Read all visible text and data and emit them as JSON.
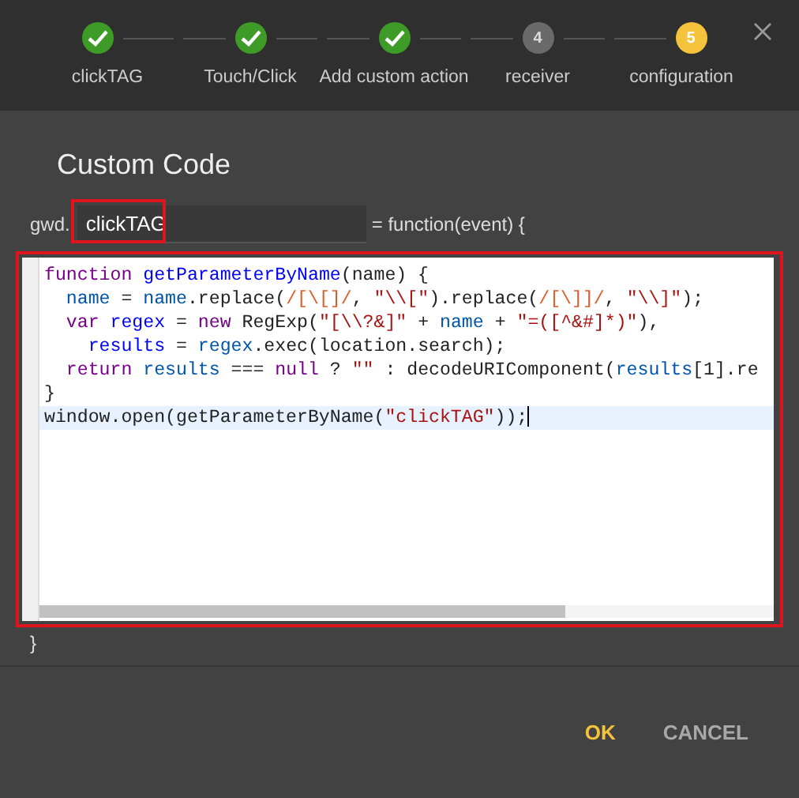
{
  "steps": [
    {
      "label": "clickTAG",
      "done": true,
      "current": false
    },
    {
      "label": "Touch/Click",
      "done": true,
      "current": false
    },
    {
      "label": "Add custom action",
      "done": true,
      "current": false
    },
    {
      "label": "receiver",
      "number": "4",
      "done": false,
      "current": false
    },
    {
      "label": "configuration",
      "number": "5",
      "done": false,
      "current": true
    }
  ],
  "title": "Custom Code",
  "signature": {
    "prefix": "gwd.",
    "value": "clickTAG",
    "suffix": "= function(event) {"
  },
  "code_lines": [
    {
      "active": false,
      "tokens": [
        {
          "kind": "keyword",
          "text": "function "
        },
        {
          "kind": "def",
          "text": "getParameterByName"
        },
        {
          "kind": "plain",
          "text": "(name) {"
        }
      ]
    },
    {
      "active": false,
      "tokens": [
        {
          "kind": "variable",
          "text": "  name"
        },
        {
          "kind": "plain",
          "text": " = "
        },
        {
          "kind": "variable",
          "text": "name"
        },
        {
          "kind": "plain",
          "text": ".replace("
        },
        {
          "kind": "regex",
          "text": "/[\\[]/"
        },
        {
          "kind": "plain",
          "text": ", "
        },
        {
          "kind": "string",
          "text": "\"\\\\[\""
        },
        {
          "kind": "plain",
          "text": ").replace("
        },
        {
          "kind": "regex",
          "text": "/[\\]]/"
        },
        {
          "kind": "plain",
          "text": ", "
        },
        {
          "kind": "string",
          "text": "\"\\\\]\""
        },
        {
          "kind": "plain",
          "text": ");"
        }
      ]
    },
    {
      "active": false,
      "tokens": [
        {
          "kind": "keyword",
          "text": "  var "
        },
        {
          "kind": "def",
          "text": "regex"
        },
        {
          "kind": "plain",
          "text": " = "
        },
        {
          "kind": "keyword",
          "text": "new"
        },
        {
          "kind": "plain",
          "text": " RegExp("
        },
        {
          "kind": "string",
          "text": "\"[\\\\?&]\""
        },
        {
          "kind": "plain",
          "text": " + "
        },
        {
          "kind": "variable",
          "text": "name"
        },
        {
          "kind": "plain",
          "text": " + "
        },
        {
          "kind": "string",
          "text": "\"=([^&#]*)\""
        },
        {
          "kind": "plain",
          "text": "),"
        }
      ]
    },
    {
      "active": false,
      "tokens": [
        {
          "kind": "def",
          "text": "    results"
        },
        {
          "kind": "plain",
          "text": " = "
        },
        {
          "kind": "variable",
          "text": "regex"
        },
        {
          "kind": "plain",
          "text": ".exec(location.search);"
        }
      ]
    },
    {
      "active": false,
      "tokens": [
        {
          "kind": "keyword",
          "text": "  return "
        },
        {
          "kind": "variable",
          "text": "results"
        },
        {
          "kind": "plain",
          "text": " === "
        },
        {
          "kind": "keyword",
          "text": "null"
        },
        {
          "kind": "plain",
          "text": " ? "
        },
        {
          "kind": "string",
          "text": "\"\""
        },
        {
          "kind": "plain",
          "text": " : decodeURIComponent("
        },
        {
          "kind": "variable",
          "text": "results"
        },
        {
          "kind": "plain",
          "text": "[1].re"
        }
      ]
    },
    {
      "active": false,
      "tokens": [
        {
          "kind": "plain",
          "text": "}"
        }
      ]
    },
    {
      "active": true,
      "tokens": [
        {
          "kind": "plain",
          "text": "window.open(getParameterByName("
        },
        {
          "kind": "string",
          "text": "\"clickTAG\""
        },
        {
          "kind": "plain",
          "text": "));"
        }
      ]
    }
  ],
  "closing": "}",
  "buttons": [
    {
      "label": "OK",
      "kind": "primary"
    },
    {
      "label": "CANCEL",
      "kind": "secondary"
    }
  ]
}
